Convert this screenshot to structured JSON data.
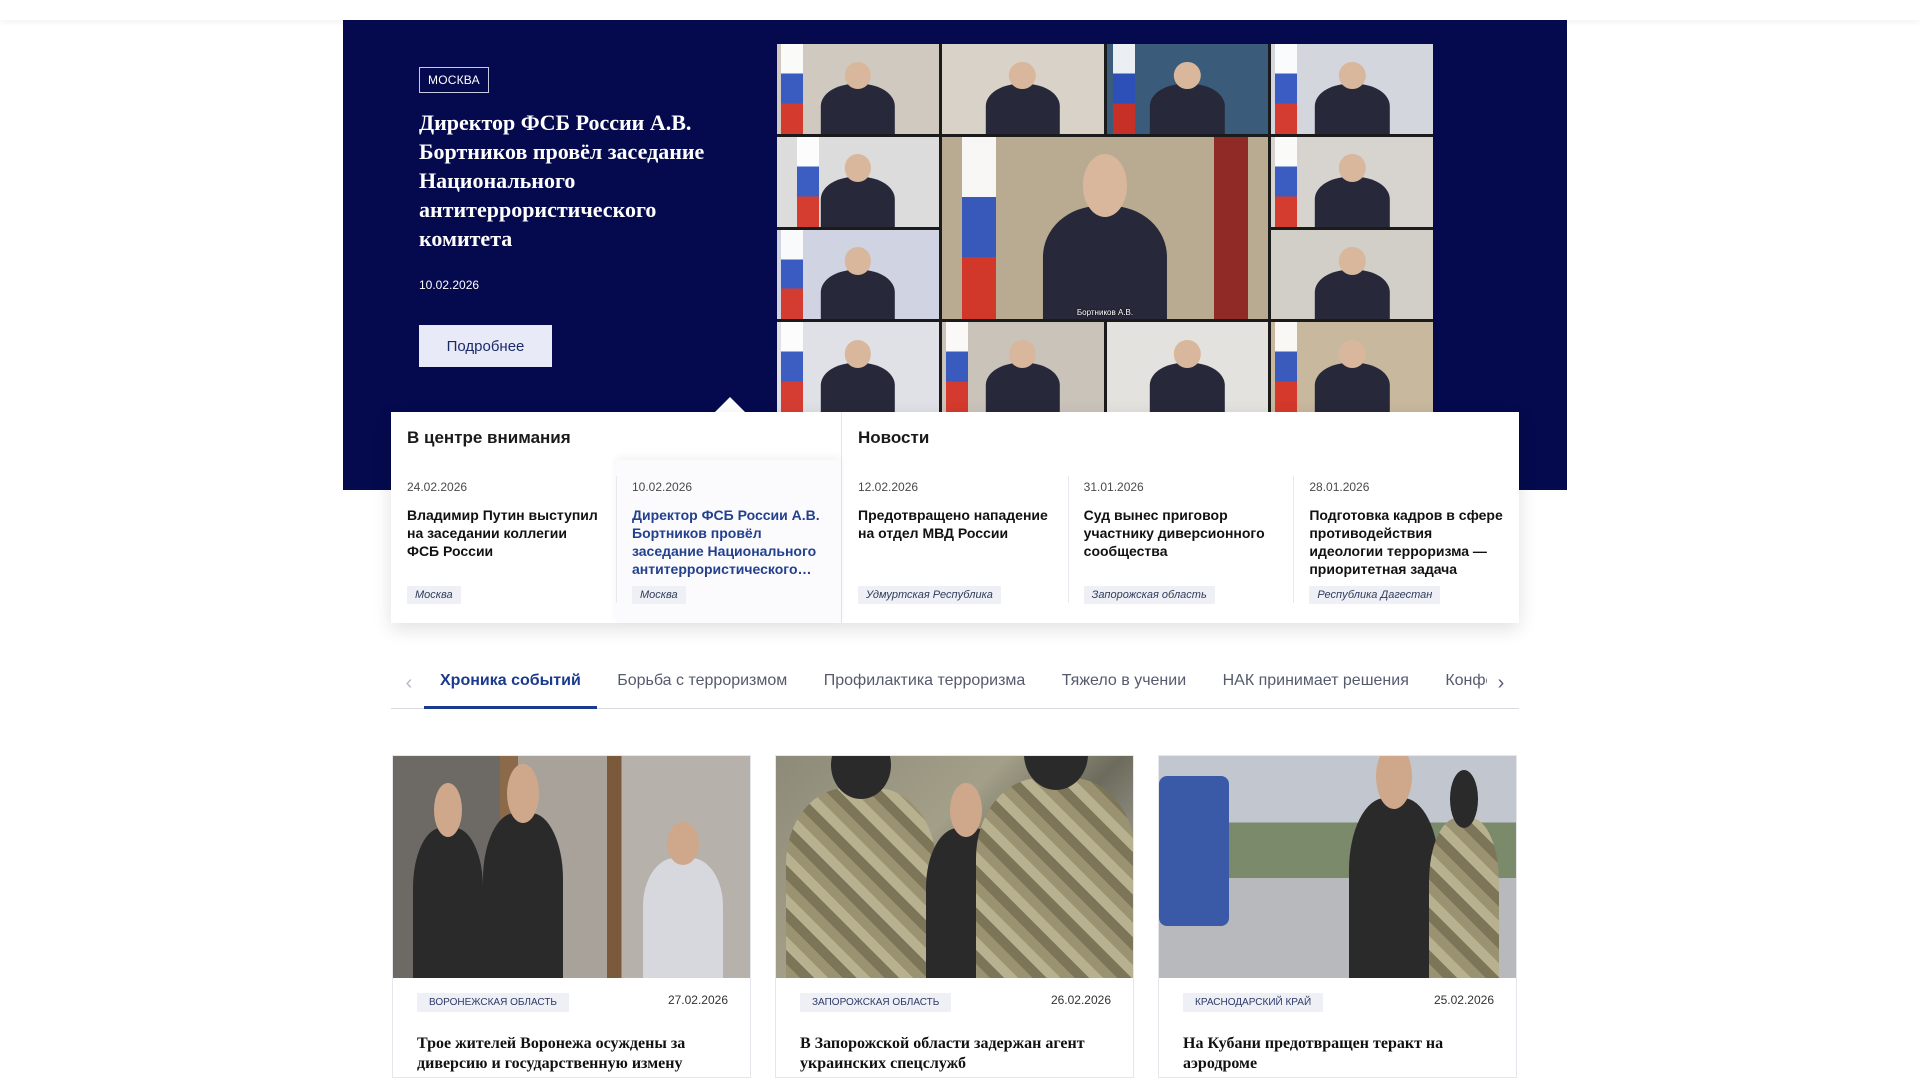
{
  "hero": {
    "region": "Москва",
    "title": "Директор ФСБ России А.В. Бортников провёл заседание Национального антитеррористического комитета",
    "date": "10.02.2026",
    "button_label": "Подробнее",
    "image_captions": [
      "Бортников А.В."
    ]
  },
  "focus": {
    "heading": "В центре внимания",
    "items": [
      {
        "date": "24.02.2026",
        "title": "Владимир Путин выступил на заседании коллегии ФСБ России",
        "tag": "Москва"
      },
      {
        "date": "10.02.2026",
        "title": "Директор ФСБ России А.В. Бортников провёл заседание Национального антитеррористического…",
        "tag": "Москва"
      }
    ]
  },
  "news": {
    "heading": "Новости",
    "items": [
      {
        "date": "12.02.2026",
        "title": "Предотвращено нападение на отдел МВД России",
        "tag": "Удмуртская Республика"
      },
      {
        "date": "31.01.2026",
        "title": "Суд вынес приговор участнику диверсионного сообщества",
        "tag": "Запорожская область"
      },
      {
        "date": "28.01.2026",
        "title": "Подготовка кадров в сфере противодействия идеологии терроризма — приоритетная задача",
        "tag": "Республика Дагестан"
      }
    ]
  },
  "tabs": {
    "items": [
      "Хроника событий",
      "Борьба с терроризмом",
      "Профилактика терроризма",
      "Тяжело в учении",
      "НАК принимает решения",
      "Конференции"
    ],
    "active": "Хроника событий"
  },
  "articles": [
    {
      "region": "Воронежская область",
      "date": "27.02.2026",
      "title": "Трое жителей Воронежа осуждены за диверсию и государственную измену"
    },
    {
      "region": "Запорожская область",
      "date": "26.02.2026",
      "title": "В Запорожской области задержан агент украинских спецслужб"
    },
    {
      "region": "Краснодарский край",
      "date": "25.02.2026",
      "title": "На Кубани предотвращен теракт на аэродроме"
    }
  ],
  "colors": {
    "hero_background": "#040a4d",
    "accent": "#1a3a8f",
    "tag_background": "#eef0f6"
  },
  "icons": {
    "tabs_prev": "chevron-left-icon",
    "tabs_next": "chevron-right-icon"
  }
}
